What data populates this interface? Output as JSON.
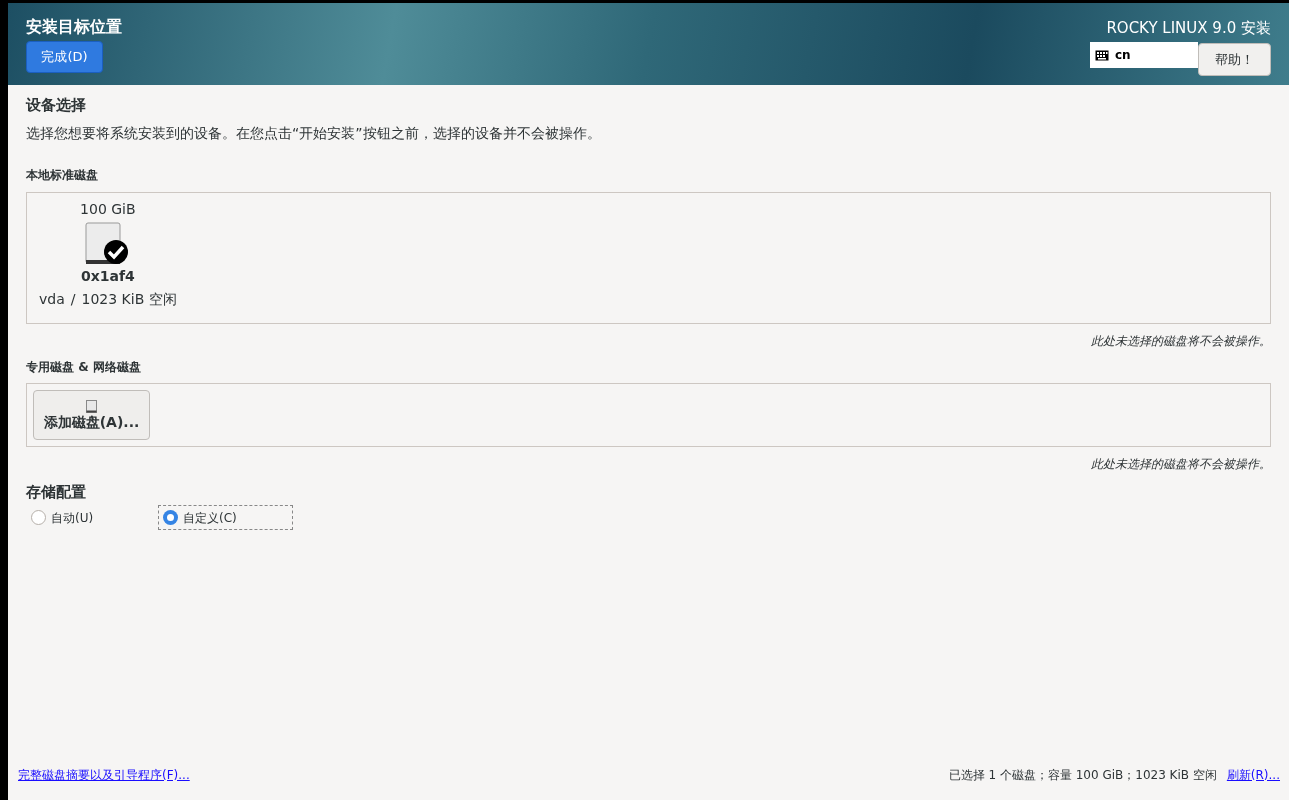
{
  "header": {
    "title": "安装目标位置",
    "done_button": "完成(D)",
    "product": "ROCKY LINUX 9.0 安装",
    "keyboard_layout": "cn",
    "help_button": "帮助！"
  },
  "device_selection": {
    "heading": "设备选择",
    "description": "选择您想要将系统安装到的设备。在您点击“开始安装”按钮之前，选择的设备并不会被操作。"
  },
  "local_disks": {
    "heading": "本地标准磁盘",
    "disks": [
      {
        "size": "100 GiB",
        "name": "0x1af4",
        "device": "vda",
        "separator": "/",
        "free": "1023 KiB 空闲",
        "selected": true
      }
    ],
    "note": "此处未选择的磁盘将不会被操作。"
  },
  "specialized_disks": {
    "heading": "专用磁盘 & 网络磁盘",
    "add_button": "添加磁盘(A)...",
    "note": "此处未选择的磁盘将不会被操作。"
  },
  "storage_configuration": {
    "heading": "存储配置",
    "options": [
      {
        "label": "自动(U)",
        "selected": false
      },
      {
        "label": "自定义(C)",
        "selected": true
      }
    ]
  },
  "footer": {
    "summary_link": "完整磁盘摘要以及引导程序(F)...",
    "status": "已选择 1 个磁盘；容量 100 GiB；1023 KiB 空闲",
    "refresh_link": "刷新(R)..."
  }
}
